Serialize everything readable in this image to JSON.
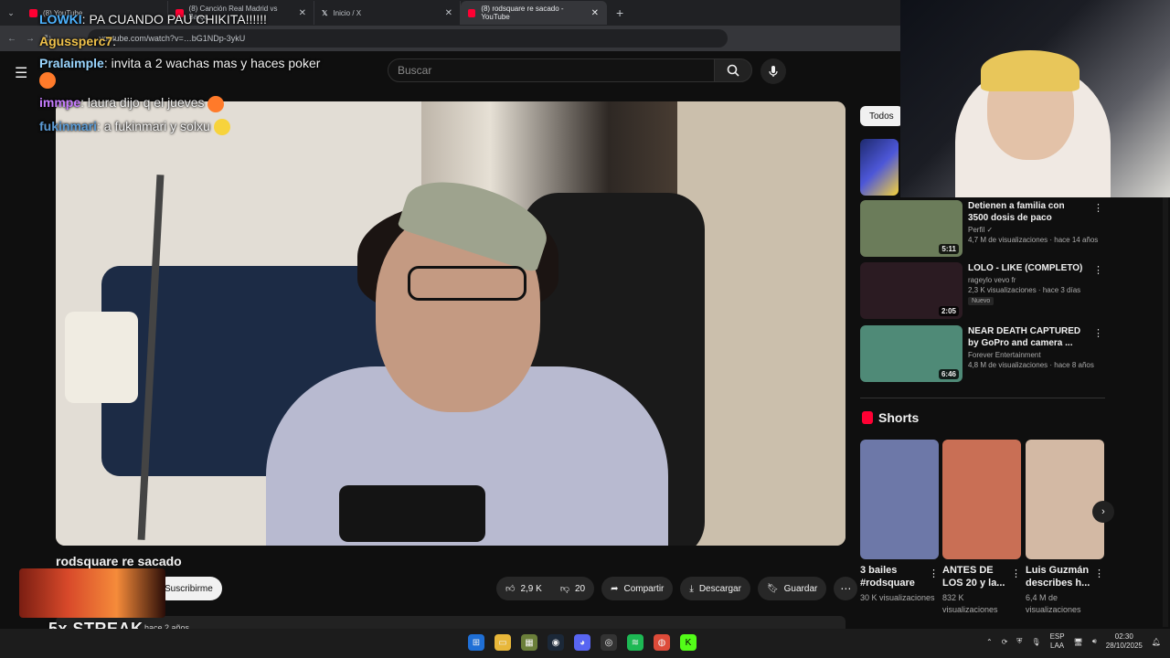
{
  "browser": {
    "tabs": [
      {
        "label": "(8) YouTube",
        "active": false
      },
      {
        "label": "(8) Canción Real Madrid vs Barça",
        "active": false
      },
      {
        "label": "Inicio / X",
        "active": false
      },
      {
        "label": "(8) rodsquare re sacado - YouTube",
        "active": true
      }
    ],
    "url": "youtube.com/watch?v=…bG1NDp-3ykU"
  },
  "youtube": {
    "search_placeholder": "Buscar",
    "video_title": "rodsquare re sacado",
    "subscribe_label": "Suscribirme",
    "date_text": "hace 2 años",
    "likes": "2,9 K",
    "dislikes": "20",
    "share_label": "Compartir",
    "download_label": "Descargar",
    "save_label": "Guardar",
    "filter_chip": "Todos"
  },
  "chat": [
    {
      "user": "LOWKI",
      "message": "PA CUANDO PAU CHIKITA!!!!!!"
    },
    {
      "user": "Agussperc7",
      "message": ""
    },
    {
      "user": "Pralaimple",
      "message": "invita a 2 wachas mas y haces poker"
    },
    {
      "user": "immpe",
      "message": "laura dijo q el jueves"
    },
    {
      "user": "fukinmari",
      "message": "a fukinmari y solxu"
    }
  ],
  "overlay": {
    "streak_text": "5x STREAK"
  },
  "recommended": [
    {
      "title": "Detienen a familia con 3500 dosis de paco",
      "channel": "Perfil ✓",
      "meta": "4,7 M de visualizaciones · hace 14 años",
      "duration": "5:11",
      "badge": "",
      "color": "#6b7c5a"
    },
    {
      "title": "LOLO - LIKE (COMPLETO)",
      "channel": "rageylo vevo fr",
      "meta": "2,3 K visualizaciones · hace 3 días",
      "duration": "2:05",
      "badge": "Nuevo",
      "color": "#2b1b22"
    },
    {
      "title": "NEAR DEATH CAPTURED by GoPro and camera ...",
      "channel": "Forever Entertainment",
      "meta": "4,8 M de visualizaciones · hace 8 años",
      "duration": "6:46",
      "badge": "",
      "color": "#4f8a77"
    }
  ],
  "shorts": {
    "heading": "Shorts",
    "items": [
      {
        "title": "3 bailes #rodsquare",
        "views": "30 K visualizaciones",
        "color": "#6d78a8"
      },
      {
        "title": "ANTES DE LOS 20 y la...",
        "views": "832 K visualizaciones",
        "color": "#c96f55"
      },
      {
        "title": "Luis Guzmán describes h...",
        "views": "6,4 M de visualizaciones",
        "color": "#d3b9a4"
      }
    ]
  },
  "taskbar": {
    "language": "ESP",
    "layout": "LAA",
    "time": "02:30",
    "date": "28/10/2025"
  }
}
